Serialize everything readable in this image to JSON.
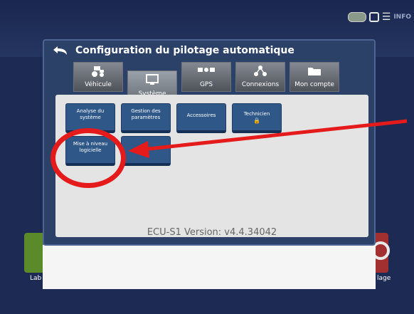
{
  "dialog": {
    "title": "Configuration du pilotage automatique"
  },
  "tabs": [
    {
      "label": "Véhicule",
      "icon": "tractor-icon"
    },
    {
      "label": "Système",
      "icon": "monitor-icon"
    },
    {
      "label": "GPS",
      "icon": "gps-receiver-icon"
    },
    {
      "label": "Connexions",
      "icon": "connections-icon"
    },
    {
      "label": "Mon compte",
      "icon": "folder-icon"
    }
  ],
  "buttons": [
    {
      "label": "Analyse du système"
    },
    {
      "label": "Gestion des paramètres"
    },
    {
      "label": "Accessoires"
    },
    {
      "label": "Technicien"
    },
    {
      "label": "Mise à niveau logicielle"
    },
    {
      "label": "..."
    }
  ],
  "version": "ECU-S1 Version: v4.4.34042",
  "background_tiles": {
    "left_label": "Lab",
    "right_label": "lage"
  },
  "status": {
    "text": "INFO"
  },
  "colors": {
    "annotation": "#e51a1a",
    "dialog_bg": "#2c4168",
    "button_blue": "#2f5888"
  }
}
